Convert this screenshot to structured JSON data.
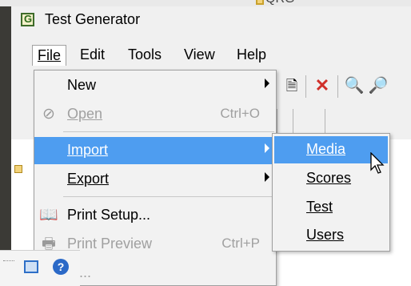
{
  "desktop": {
    "background_label": "QRG"
  },
  "app": {
    "title": "Test Generator"
  },
  "menubar": {
    "file": "File",
    "edit": "Edit",
    "tools": "Tools",
    "view": "View",
    "help": "Help"
  },
  "file_menu": {
    "new": {
      "label": "New"
    },
    "open": {
      "label": "Open",
      "shortcut": "Ctrl+O"
    },
    "import": {
      "label": "Import"
    },
    "export": {
      "label": "Export"
    },
    "print_setup": {
      "label": "Print Setup..."
    },
    "print_preview": {
      "label": "Print Preview",
      "shortcut": "Ctrl+P"
    },
    "print": {
      "label": "nt..."
    }
  },
  "import_submenu": {
    "media": "Media",
    "scores": "Scores",
    "test": "Test",
    "users": "Users"
  },
  "taskbar": {
    "help": "?"
  },
  "colors": {
    "highlight": "#4e9df0",
    "delete": "#d0302a"
  }
}
